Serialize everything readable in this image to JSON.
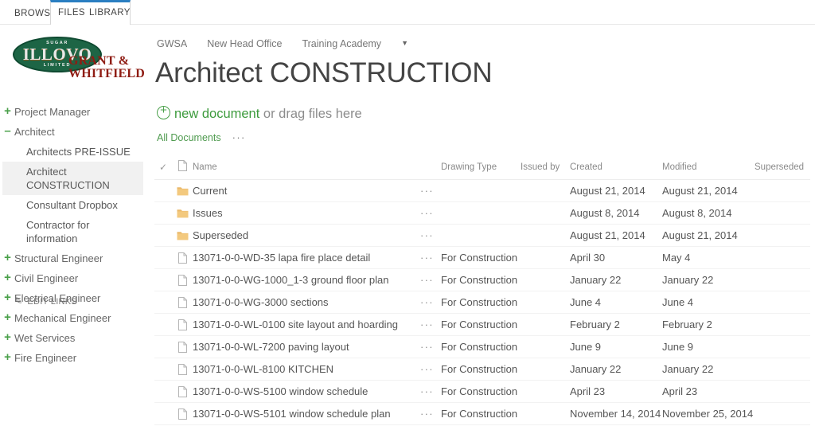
{
  "ribbon": {
    "browse_tab": "BROWSE",
    "files_tab": "FILES",
    "library_tab": "LIBRARY",
    "accent_color": "#2a7ec1"
  },
  "logo": {
    "sugar_text": "SUGAR",
    "brand_text": "ILLOVO",
    "limited_text": "LIMITED",
    "partner_line1": "GRANT &",
    "partner_line2": "WHITFIELD",
    "oval_color": "#1d6545",
    "partner_color": "#8f1c13"
  },
  "sidebar": {
    "accent_color": "#4aa04a",
    "items": [
      {
        "label": "Project Manager",
        "marker": "+",
        "level": "top",
        "selected": false
      },
      {
        "label": "Architect",
        "marker": "–",
        "level": "top",
        "selected": false
      },
      {
        "label": "Architects PRE-ISSUE",
        "marker": "",
        "level": "child",
        "selected": false
      },
      {
        "label": "Architect CONSTRUCTION",
        "marker": "",
        "level": "child",
        "selected": true
      },
      {
        "label": "Consultant Dropbox",
        "marker": "",
        "level": "child",
        "selected": false
      },
      {
        "label": "Contractor for information",
        "marker": "",
        "level": "child",
        "selected": false
      },
      {
        "label": "Structural Engineer",
        "marker": "+",
        "level": "top",
        "selected": false
      },
      {
        "label": "Civil Engineer",
        "marker": "+",
        "level": "top",
        "selected": false
      },
      {
        "label": "Electrical Engineer",
        "marker": "+",
        "level": "top",
        "selected": false
      },
      {
        "label": "Mechanical Engineer",
        "marker": "+",
        "level": "top",
        "selected": false
      },
      {
        "label": "Wet Services",
        "marker": "+",
        "level": "top",
        "selected": false
      },
      {
        "label": "Fire Engineer",
        "marker": "+",
        "level": "top",
        "selected": false
      }
    ],
    "edit_links_label": "EDIT LINKS"
  },
  "header": {
    "breadcrumb": [
      "GWSA",
      "New Head Office",
      "Training Academy"
    ],
    "breadcrumb_caret": "▼",
    "page_title": "Architect CONSTRUCTION"
  },
  "toolbar": {
    "new_document_label": "new document",
    "drag_files_label": "or drag files here",
    "current_view": "All Documents",
    "view_menu_ellipsis": "···"
  },
  "table": {
    "columns": [
      "",
      "",
      "Name",
      "",
      "Drawing Type",
      "Issued by",
      "Created",
      "Modified",
      "Superseded"
    ],
    "header_name": "Name",
    "header_drawing_type": "Drawing Type",
    "header_issued_by": "Issued by",
    "header_created": "Created",
    "header_modified": "Modified",
    "header_superseded": "Superseded",
    "select_all_check": "✓",
    "row_ellipsis": "···",
    "rows": [
      {
        "kind": "folder",
        "name": "Current",
        "drawing_type": "",
        "issued_by": "",
        "created": "August 21, 2014",
        "modified": "August 21, 2014",
        "superseded": ""
      },
      {
        "kind": "folder",
        "name": "Issues",
        "drawing_type": "",
        "issued_by": "",
        "created": "August 8, 2014",
        "modified": "August 8, 2014",
        "superseded": ""
      },
      {
        "kind": "folder",
        "name": "Superseded",
        "drawing_type": "",
        "issued_by": "",
        "created": "August 21, 2014",
        "modified": "August 21, 2014",
        "superseded": ""
      },
      {
        "kind": "file",
        "name": "13071-0-0-WD-35 lapa fire place detail",
        "drawing_type": "For Construction",
        "issued_by": "",
        "created": "April 30",
        "modified": "May 4",
        "superseded": ""
      },
      {
        "kind": "file",
        "name": "13071-0-0-WG-1000_1-3 ground floor plan",
        "drawing_type": "For Construction",
        "issued_by": "",
        "created": "January 22",
        "modified": "January 22",
        "superseded": ""
      },
      {
        "kind": "file",
        "name": "13071-0-0-WG-3000 sections",
        "drawing_type": "For Construction",
        "issued_by": "",
        "created": "June 4",
        "modified": "June 4",
        "superseded": ""
      },
      {
        "kind": "file",
        "name": "13071-0-0-WL-0100 site layout and hoarding",
        "drawing_type": "For Construction",
        "issued_by": "",
        "created": "February 2",
        "modified": "February 2",
        "superseded": ""
      },
      {
        "kind": "file",
        "name": "13071-0-0-WL-7200 paving layout",
        "drawing_type": "For Construction",
        "issued_by": "",
        "created": "June 9",
        "modified": "June 9",
        "superseded": ""
      },
      {
        "kind": "file",
        "name": "13071-0-0-WL-8100 KITCHEN",
        "drawing_type": "For Construction",
        "issued_by": "",
        "created": "January 22",
        "modified": "January 22",
        "superseded": ""
      },
      {
        "kind": "file",
        "name": "13071-0-0-WS-5100 window schedule",
        "drawing_type": "For Construction",
        "issued_by": "",
        "created": "April 23",
        "modified": "April 23",
        "superseded": ""
      },
      {
        "kind": "file",
        "name": "13071-0-0-WS-5101 window schedule plan",
        "drawing_type": "For Construction",
        "issued_by": "",
        "created": "November 14, 2014",
        "modified": "November 25, 2014",
        "superseded": ""
      }
    ]
  }
}
